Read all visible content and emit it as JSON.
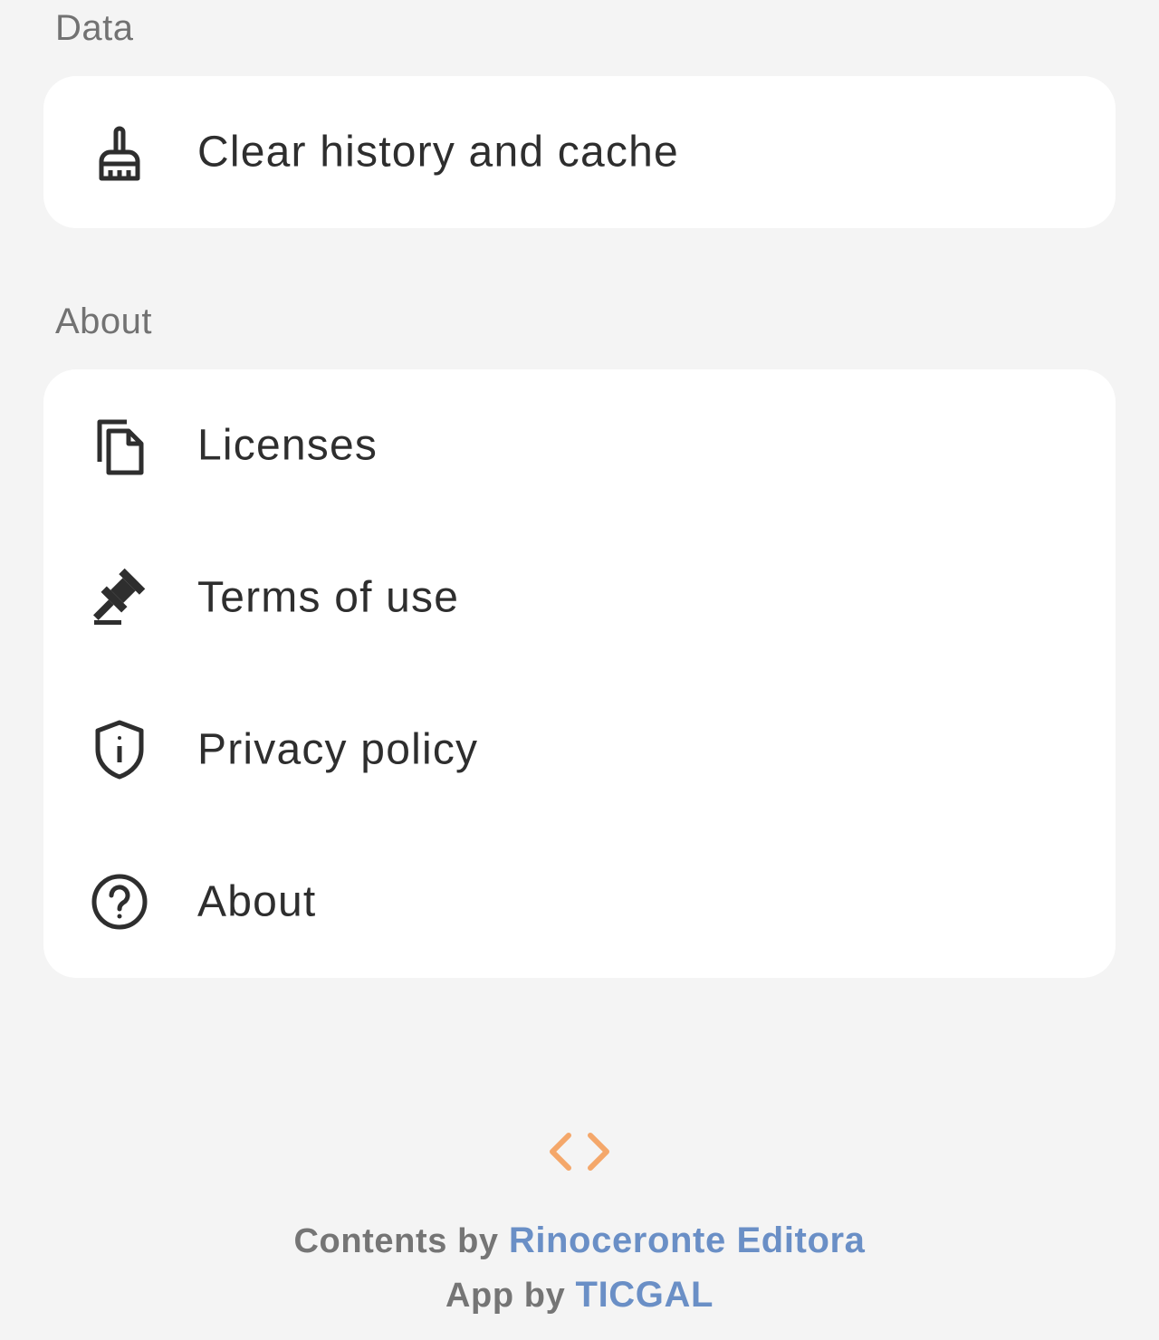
{
  "sections": {
    "data": {
      "header": "Data",
      "items": [
        {
          "label": "Clear history and cache",
          "icon": "broom-icon"
        }
      ]
    },
    "about": {
      "header": "About",
      "items": [
        {
          "label": "Licenses",
          "icon": "copy-document-icon"
        },
        {
          "label": "Terms of use",
          "icon": "gavel-icon"
        },
        {
          "label": "Privacy policy",
          "icon": "shield-info-icon"
        },
        {
          "label": "About",
          "icon": "help-circle-icon"
        }
      ]
    }
  },
  "footer": {
    "logo_icon": "code-brackets-icon",
    "contents_prefix": "Contents by",
    "contents_link": "Rinoceronte Editora",
    "app_prefix": "App by",
    "app_link": "TICGAL"
  },
  "colors": {
    "background": "#f4f4f4",
    "card": "#ffffff",
    "text": "#2e2e2e",
    "section_header": "#727272",
    "link": "#6a8fc6",
    "logo_accent": "#f4a76a"
  }
}
